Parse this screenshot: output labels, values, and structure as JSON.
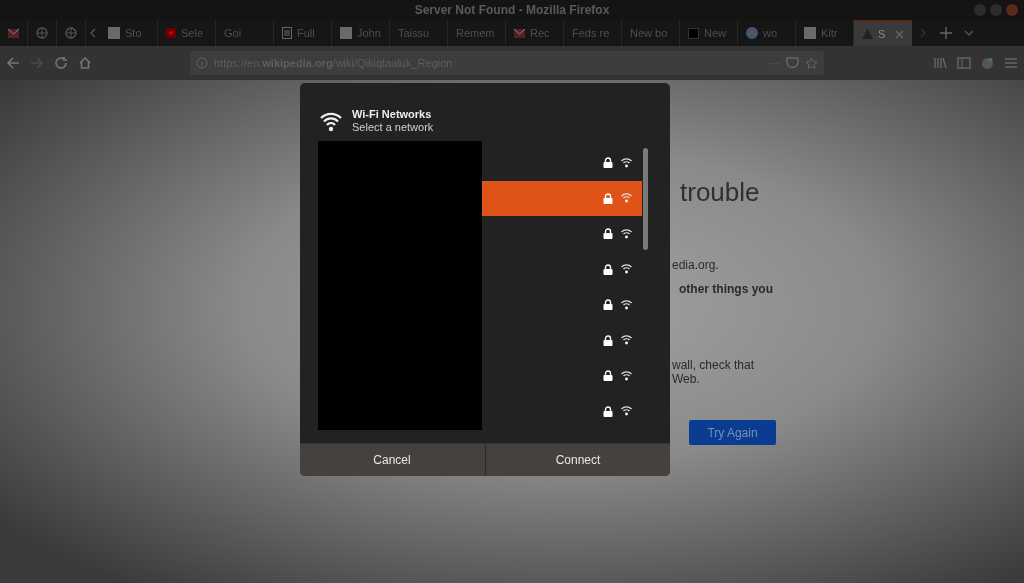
{
  "window": {
    "title": "Server Not Found - Mozilla Firefox"
  },
  "tabs": [
    {
      "kind": "mail",
      "selected": false
    },
    {
      "kind": "globe",
      "selected": false
    },
    {
      "kind": "globe",
      "selected": false
    },
    {
      "kind": "wiki",
      "label": "Sto",
      "selected": false
    },
    {
      "kind": "dot",
      "label": "Sele",
      "selected": false
    },
    {
      "kind": "plain",
      "label": "Goi",
      "selected": false
    },
    {
      "kind": "doc",
      "label": "Full",
      "selected": false
    },
    {
      "kind": "wiki",
      "label": "John",
      "selected": false
    },
    {
      "kind": "plain",
      "label": "Taissu",
      "selected": false
    },
    {
      "kind": "plain",
      "label": "Remem",
      "selected": false
    },
    {
      "kind": "mail",
      "label": "Rec",
      "selected": false
    },
    {
      "kind": "plain",
      "label": "Feds re",
      "selected": false
    },
    {
      "kind": "plain",
      "label": "New bo",
      "selected": false
    },
    {
      "kind": "square",
      "label": "New",
      "selected": false
    },
    {
      "kind": "circle",
      "label": "wo",
      "selected": false
    },
    {
      "kind": "wiki",
      "label": "Kitr",
      "selected": false
    },
    {
      "kind": "warning",
      "label": "S",
      "selected": true
    }
  ],
  "address_bar": {
    "url": "https://en.**wikipedia.org**/wiki/Qikiqtaaluk_Region",
    "more": "···"
  },
  "page": {
    "heading": "trouble",
    "lines": [
      {
        "text": "edia.org.",
        "bold": false
      },
      {
        "text": "other things you",
        "bold": true
      },
      {
        "text": "wall, check that",
        "bold": false
      },
      {
        "text": "Web.",
        "bold": false
      }
    ],
    "button": "Try Again"
  },
  "dialog": {
    "title": "Wi-Fi Networks",
    "subtitle": "Select a network",
    "networks": [
      {
        "selected": false,
        "secured": true
      },
      {
        "selected": true,
        "secured": true
      },
      {
        "selected": false,
        "secured": true
      },
      {
        "selected": false,
        "secured": true
      },
      {
        "selected": false,
        "secured": true
      },
      {
        "selected": false,
        "secured": true
      },
      {
        "selected": false,
        "secured": true
      },
      {
        "selected": false,
        "secured": true
      }
    ],
    "buttons": [
      "Cancel",
      "Connect"
    ]
  }
}
